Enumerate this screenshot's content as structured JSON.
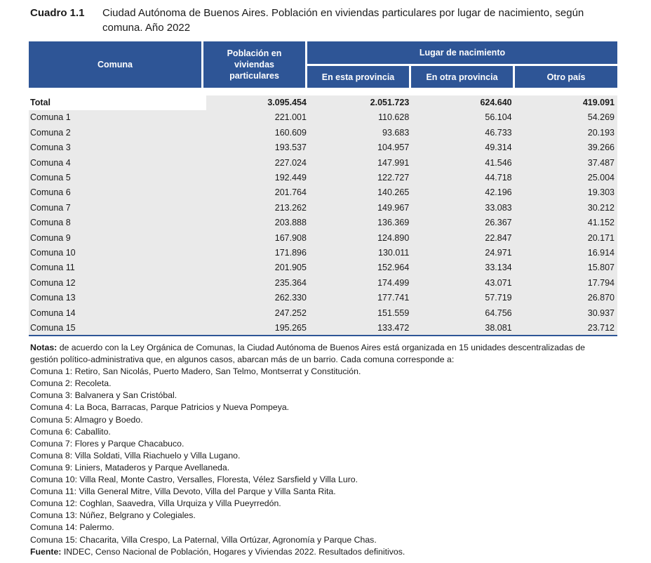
{
  "title": {
    "code": "Cuadro 1.1",
    "text": "Ciudad Autónoma de Buenos Aires. Población en viviendas particulares por lugar de nacimiento, según comuna. Año 2022"
  },
  "header": {
    "comuna": "Comuna",
    "poblacion": "Población en viviendas particulares",
    "lugar": "Lugar de nacimiento",
    "esta_provincia": "En esta provincia",
    "otra_provincia": "En otra provincia",
    "otro_pais": "Otro país"
  },
  "rows": [
    {
      "name": "Total",
      "pop": "3.095.454",
      "esta": "2.051.723",
      "otra": "624.640",
      "pais": "419.091"
    },
    {
      "name": "Comuna 1",
      "pop": "221.001",
      "esta": "110.628",
      "otra": "56.104",
      "pais": "54.269"
    },
    {
      "name": "Comuna 2",
      "pop": "160.609",
      "esta": "93.683",
      "otra": "46.733",
      "pais": "20.193"
    },
    {
      "name": "Comuna 3",
      "pop": "193.537",
      "esta": "104.957",
      "otra": "49.314",
      "pais": "39.266"
    },
    {
      "name": "Comuna 4",
      "pop": "227.024",
      "esta": "147.991",
      "otra": "41.546",
      "pais": "37.487"
    },
    {
      "name": "Comuna 5",
      "pop": "192.449",
      "esta": "122.727",
      "otra": "44.718",
      "pais": "25.004"
    },
    {
      "name": "Comuna 6",
      "pop": "201.764",
      "esta": "140.265",
      "otra": "42.196",
      "pais": "19.303"
    },
    {
      "name": "Comuna 7",
      "pop": "213.262",
      "esta": "149.967",
      "otra": "33.083",
      "pais": "30.212"
    },
    {
      "name": "Comuna 8",
      "pop": "203.888",
      "esta": "136.369",
      "otra": "26.367",
      "pais": "41.152"
    },
    {
      "name": "Comuna 9",
      "pop": "167.908",
      "esta": "124.890",
      "otra": "22.847",
      "pais": "20.171"
    },
    {
      "name": "Comuna 10",
      "pop": "171.896",
      "esta": "130.011",
      "otra": "24.971",
      "pais": "16.914"
    },
    {
      "name": "Comuna 11",
      "pop": "201.905",
      "esta": "152.964",
      "otra": "33.134",
      "pais": "15.807"
    },
    {
      "name": "Comuna 12",
      "pop": "235.364",
      "esta": "174.499",
      "otra": "43.071",
      "pais": "17.794"
    },
    {
      "name": "Comuna 13",
      "pop": "262.330",
      "esta": "177.741",
      "otra": "57.719",
      "pais": "26.870"
    },
    {
      "name": "Comuna 14",
      "pop": "247.252",
      "esta": "151.559",
      "otra": "64.756",
      "pais": "30.937"
    },
    {
      "name": "Comuna 15",
      "pop": "195.265",
      "esta": "133.472",
      "otra": "38.081",
      "pais": "23.712"
    }
  ],
  "notes": {
    "label": "Notas:",
    "intro": "de acuerdo con la Ley Orgánica de Comunas, la Ciudad Autónoma de Buenos Aires está organizada en 15 unidades descentralizadas de gestión político-administrativa que, en algunos casos, abarcan más de un barrio. Cada comuna corresponde a:",
    "lines": [
      "Comuna 1: Retiro, San Nicolás, Puerto Madero, San Telmo, Montserrat y Constitución.",
      "Comuna 2: Recoleta.",
      "Comuna 3: Balvanera y San Cristóbal.",
      "Comuna 4: La Boca, Barracas, Parque Patricios y Nueva Pompeya.",
      "Comuna 5: Almagro y Boedo.",
      "Comuna 6: Caballito.",
      "Comuna 7: Flores y Parque Chacabuco.",
      "Comuna 8: Villa Soldati, Villa Riachuelo y Villa Lugano.",
      "Comuna 9: Liniers, Mataderos y Parque Avellaneda.",
      "Comuna 10: Villa Real, Monte Castro, Versalles, Floresta, Vélez Sarsfield y Villa Luro.",
      "Comuna 11: Villa General Mitre, Villa Devoto, Villa del Parque y Villa Santa Rita.",
      "Comuna 12: Coghlan, Saavedra, Villa Urquiza y Villa Pueyrredón.",
      "Comuna 13: Núñez, Belgrano y Colegiales.",
      "Comuna 14: Palermo.",
      "Comuna 15: Chacarita, Villa Crespo, La Paternal, Villa Ortúzar, Agronomía y Parque Chas."
    ]
  },
  "source": {
    "label": "Fuente:",
    "text": "INDEC, Censo Nacional de Población, Hogares y Viviendas 2022. Resultados definitivos."
  },
  "colors": {
    "header_bg": "#2e5596",
    "header_text": "#ffffff",
    "shaded_cell": "#eaeaea"
  }
}
